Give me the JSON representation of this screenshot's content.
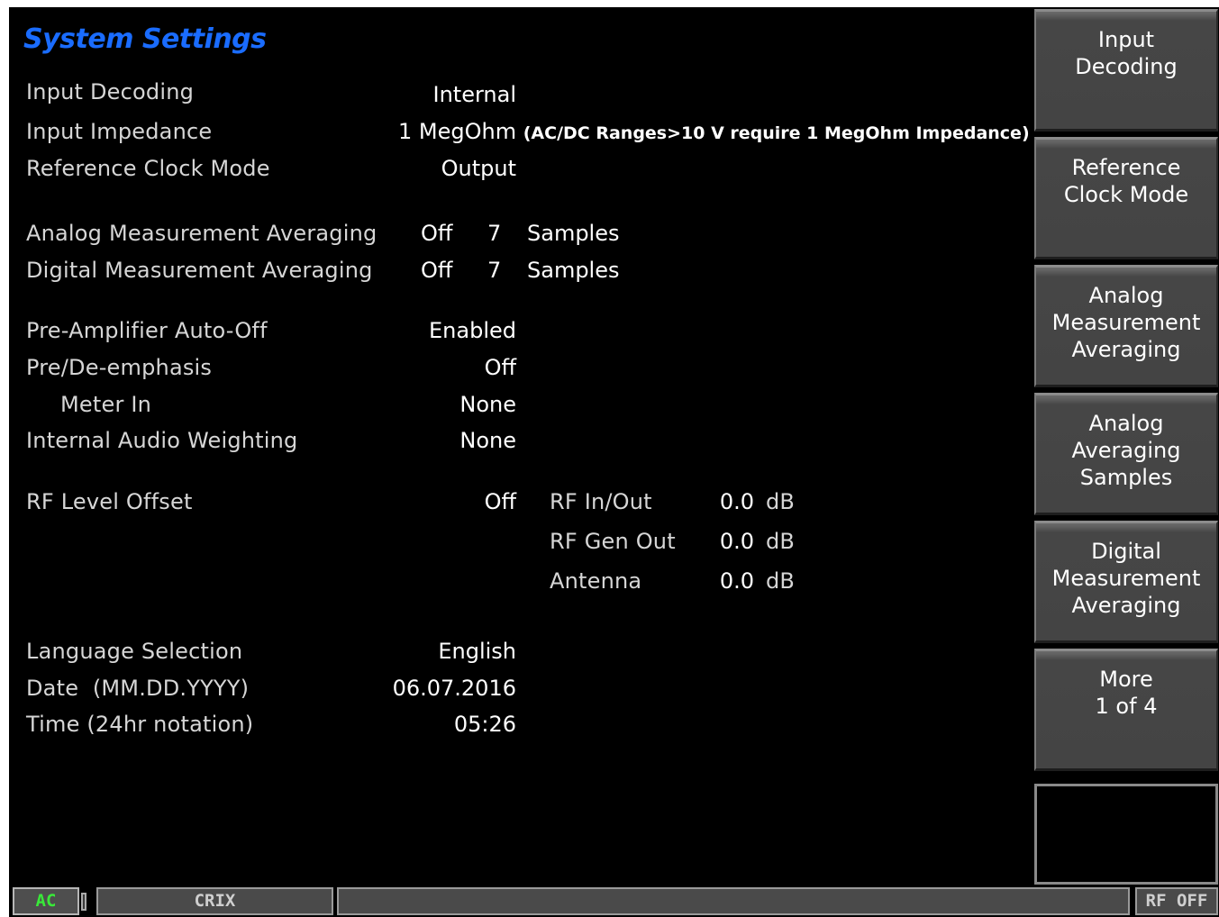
{
  "title": "System Settings",
  "settings": {
    "input_decoding": {
      "label": "Input Decoding",
      "value": "Internal"
    },
    "input_impedance": {
      "label": "Input Impedance",
      "value": "1 MegOhm",
      "note": "(AC/DC Ranges>10 V require 1 MegOhm Impedance)"
    },
    "ref_clock_mode": {
      "label": "Reference Clock Mode",
      "value": "Output"
    },
    "analog_avg": {
      "label": "Analog Measurement Averaging",
      "state": "Off",
      "samples": "7",
      "unit": "Samples"
    },
    "digital_avg": {
      "label": "Digital Measurement Averaging",
      "state": "Off",
      "samples": "7",
      "unit": "Samples"
    },
    "preamp_auto_off": {
      "label": "Pre-Amplifier Auto-Off",
      "value": "Enabled"
    },
    "pre_de_emphasis": {
      "label": "Pre/De-emphasis",
      "value": "Off"
    },
    "meter_in": {
      "label": "Meter In",
      "value": "None"
    },
    "internal_audio_weighting": {
      "label": "Internal Audio Weighting",
      "value": "None"
    },
    "rf_level_offset": {
      "label": "RF Level Offset",
      "value": "Off",
      "rows": [
        {
          "name": "RF In/Out",
          "value": "0.0",
          "unit": "dB"
        },
        {
          "name": "RF Gen Out",
          "value": "0.0",
          "unit": "dB"
        },
        {
          "name": "Antenna",
          "value": "0.0",
          "unit": "dB"
        }
      ]
    },
    "language": {
      "label": "Language Selection",
      "value": "English"
    },
    "date": {
      "label": "Date  (MM.DD.YYYY)",
      "value": "06.07.2016"
    },
    "time": {
      "label": "Time (24hr notation)",
      "value": "05:26"
    }
  },
  "softkeys": [
    {
      "lines": [
        "Input",
        "Decoding"
      ]
    },
    {
      "lines": [
        "Reference",
        "Clock Mode"
      ]
    },
    {
      "lines": [
        "Analog",
        "Measurement",
        "Averaging"
      ]
    },
    {
      "lines": [
        "Analog",
        "Averaging",
        "Samples"
      ]
    },
    {
      "lines": [
        "Digital",
        "Measurement",
        "Averaging"
      ]
    },
    {
      "lines": [
        "More",
        "1 of 4"
      ]
    }
  ],
  "status_bar": {
    "coupling": "AC",
    "mode": "CRIX",
    "message": "",
    "rf": "RF OFF"
  },
  "colors": {
    "title": "#1a6cff",
    "background": "#000000",
    "softkey": "#454545",
    "coupling_text": "#39e939"
  }
}
